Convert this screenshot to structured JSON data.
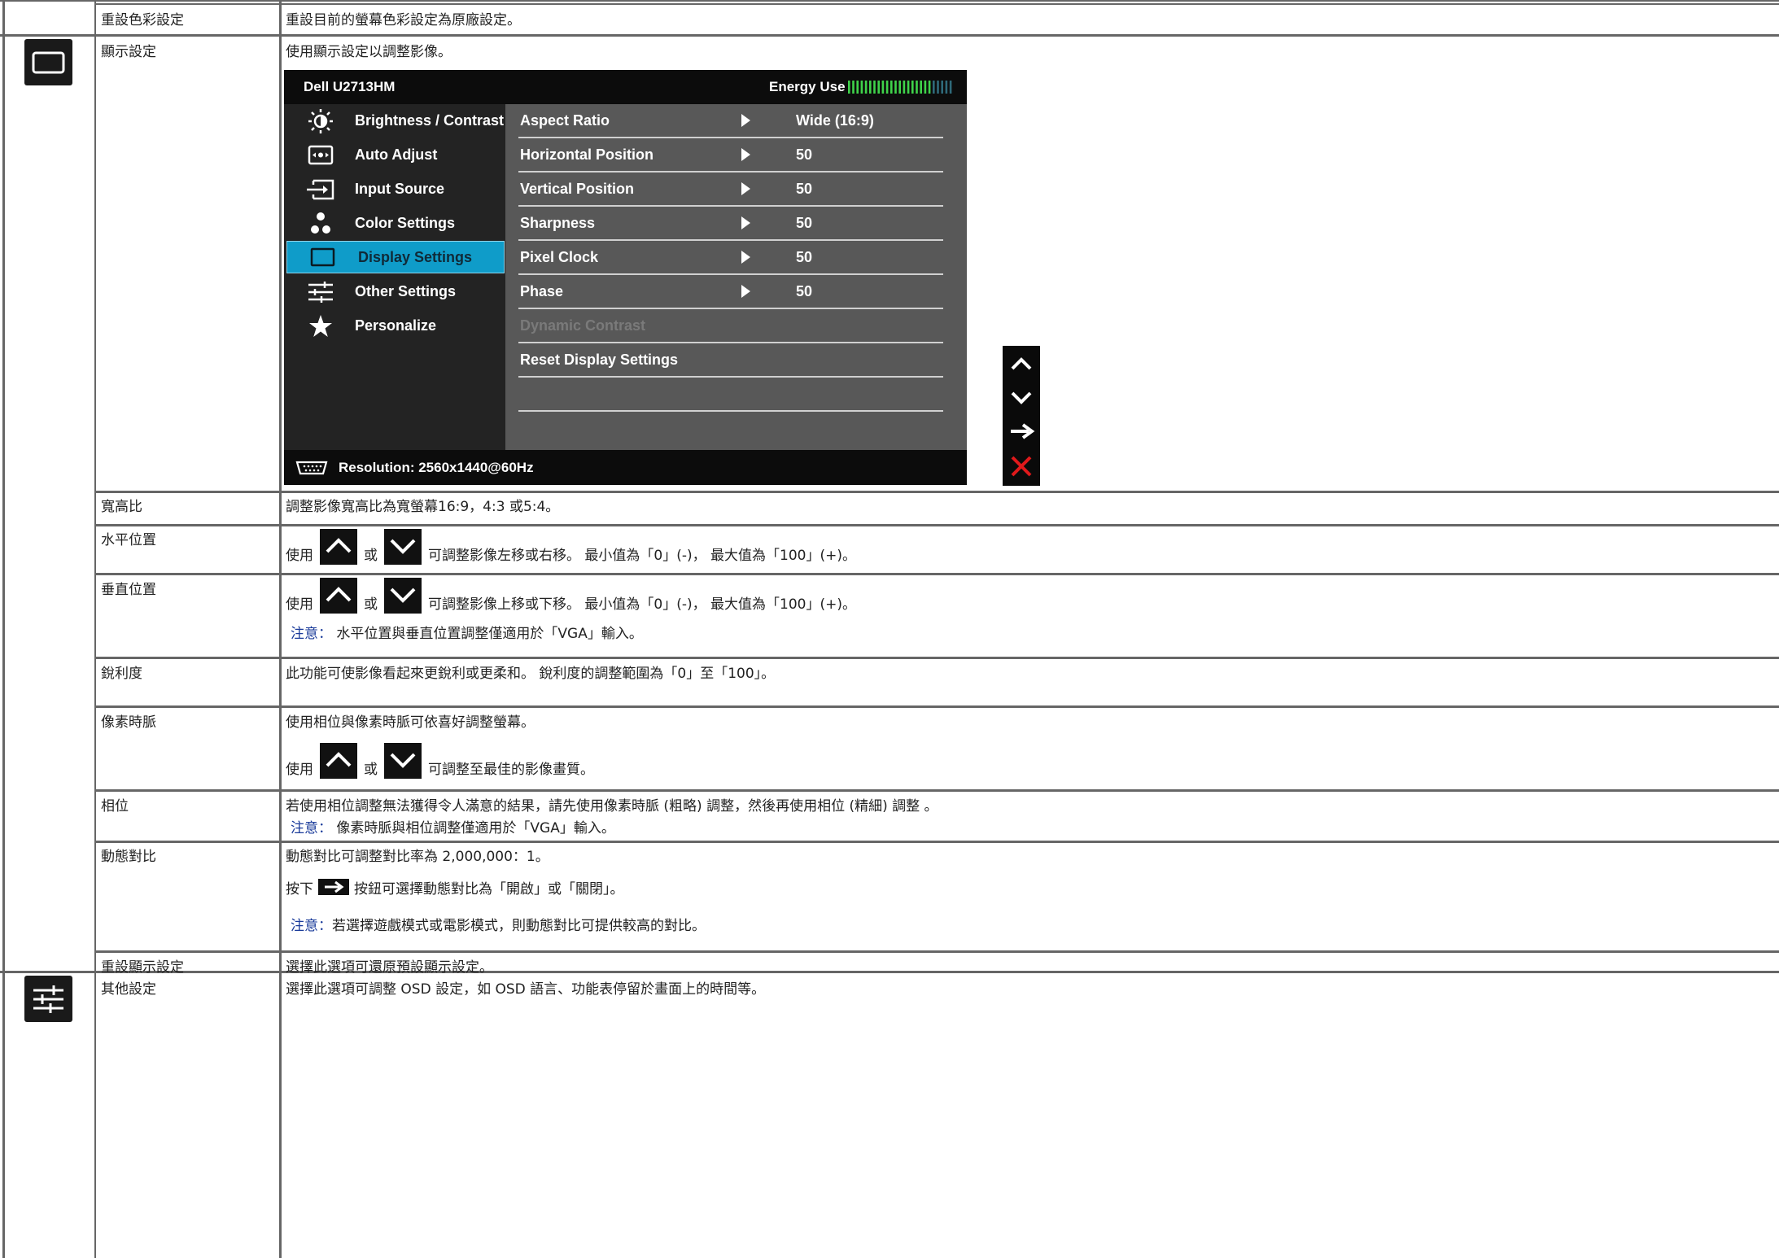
{
  "rows": {
    "reset_color": {
      "label": "重設色彩設定",
      "desc": "重設目前的螢幕色彩設定為原廠設定。"
    },
    "display": {
      "label": "顯示設定",
      "desc": "使用顯示設定以調整影像。"
    },
    "aspect": {
      "label": "寬高比",
      "desc": "調整影像寬高比為寬螢幕16:9，4:3 或5:4。"
    },
    "hpos": {
      "label": "水平位置",
      "pre": "使用",
      "or": "或",
      "post": "可調整影像左移或右移。 最小值為「0」(-)， 最大值為「100」(+)。"
    },
    "vpos": {
      "label": "垂直位置",
      "pre": "使用",
      "or": "或",
      "post": "可調整影像上移或下移。 最小值為「0」(-)， 最大值為「100」(+)。",
      "note_label": "注意：",
      "note": " 水平位置與垂直位置調整僅適用於「VGA」輸入。"
    },
    "sharpness": {
      "label": "銳利度",
      "desc": "此功能可使影像看起來更銳利或更柔和。 銳利度的調整範圍為「0」至「100」。"
    },
    "pixel_clock": {
      "label": "像素時脈",
      "desc": "使用相位與像素時脈可依喜好調整螢幕。",
      "pre": "使用",
      "or": "或",
      "post": "可調整至最佳的影像畫質。"
    },
    "phase": {
      "label": "相位",
      "desc": "若使用相位調整無法獲得令人滿意的結果，請先使用像素時脈 (粗略) 調整，然後再使用相位 (精細) 調整 。",
      "note_label": "注意：",
      "note": " 像素時脈與相位調整僅適用於「VGA」輸入。"
    },
    "dynamic": {
      "label": "動態對比",
      "desc": "動態對比可調整對比率為 2,000,000：1。",
      "press_pre": "按下",
      "press_post": "按鈕可選擇動態對比為「開啟」或「關閉」。",
      "note_label": "注意：",
      "note": "若選擇遊戲模式或電影模式，則動態對比可提供較高的對比。"
    },
    "reset_display": {
      "label": "重設顯示設定",
      "desc": "選擇此選項可還原預設顯示設定。"
    },
    "other": {
      "label": "其他設定",
      "desc": "選擇此選項可調整 OSD 設定，如 OSD 語言、功能表停留於畫面上的時間等。"
    }
  },
  "osd": {
    "model": "Dell U2713HM",
    "energy_label": "Energy Use",
    "energy_level": 0.8,
    "menu": [
      {
        "label": "Brightness / Contrast",
        "icon": "brightness-icon"
      },
      {
        "label": "Auto Adjust",
        "icon": "auto-adjust-icon"
      },
      {
        "label": "Input Source",
        "icon": "input-source-icon"
      },
      {
        "label": "Color Settings",
        "icon": "color-settings-icon"
      },
      {
        "label": "Display Settings",
        "icon": "display-settings-icon",
        "selected": true
      },
      {
        "label": "Other Settings",
        "icon": "other-settings-icon"
      },
      {
        "label": "Personalize",
        "icon": "star-icon"
      }
    ],
    "settings": [
      {
        "name": "Aspect Ratio",
        "value": "Wide (16:9)"
      },
      {
        "name": "Horizontal Position",
        "value": "50"
      },
      {
        "name": "Vertical Position",
        "value": "50"
      },
      {
        "name": "Sharpness",
        "value": "50"
      },
      {
        "name": "Pixel Clock",
        "value": "50"
      },
      {
        "name": "Phase",
        "value": "50"
      },
      {
        "name": "Dynamic Contrast",
        "value": "",
        "disabled": true
      },
      {
        "name": "Reset Display Settings",
        "value": ""
      }
    ],
    "resolution": "Resolution: 2560x1440@60Hz"
  },
  "colors": {
    "osd_highlight": "#0f9cc9",
    "note": "#1a3b9a",
    "energy_green": "#3fd24a",
    "close_red": "#e0191b"
  }
}
